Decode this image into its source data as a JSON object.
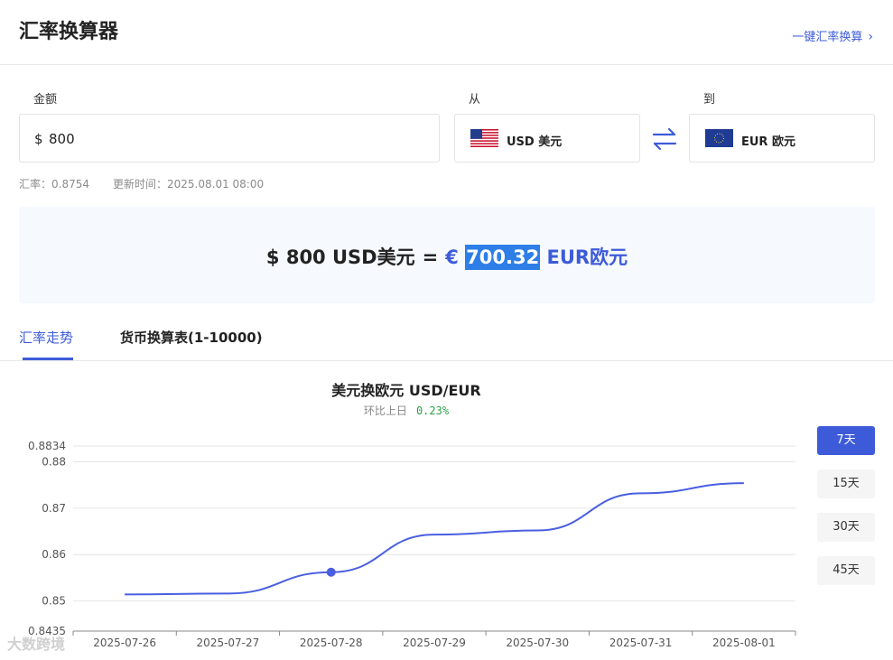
{
  "header": {
    "title": "汇率换算器",
    "quick_link": "一键汇率换算"
  },
  "form": {
    "amount_label": "金额",
    "amount_symbol": "$",
    "amount_value": "800",
    "from_label": "从",
    "from_currency": "USD  美元",
    "to_label": "到",
    "to_currency": "EUR  欧元"
  },
  "rate_info": {
    "rate": "汇率：0.8754",
    "updated": "更新时间：2025.08.01 08:00"
  },
  "result": {
    "left": "$ 800  USD美元",
    "equals": "=",
    "symbol": "€",
    "value": "700.32",
    "currency": "EUR欧元"
  },
  "tabs": [
    {
      "label": "汇率走势",
      "active": true
    },
    {
      "label": "货币换算表(1-10000)",
      "active": false
    }
  ],
  "chart_header": {
    "title": "美元换欧元   USD/EUR",
    "change_label": "环比上日",
    "change_value": "0.23%"
  },
  "ranges": [
    "7天",
    "15天",
    "30天",
    "45天"
  ],
  "colors": {
    "accent": "#3d5bd9",
    "positive": "#2ea04a",
    "line": "#4a5fe0"
  },
  "icons": {
    "swap": "swap-arrows-icon",
    "chevron": "chevron-right-icon"
  },
  "chart_data": {
    "type": "line",
    "title": "美元换欧元   USD/EUR",
    "x": [
      "2025-07-26",
      "2025-07-27",
      "2025-07-28",
      "2025-07-29",
      "2025-07-30",
      "2025-07-31",
      "2025-08-01"
    ],
    "values": [
      0.8514,
      0.8516,
      0.8562,
      0.8643,
      0.8652,
      0.8732,
      0.8754
    ],
    "ylim": [
      0.8435,
      0.8834
    ],
    "yticks": [
      "0.8834",
      "0.88",
      "0.87",
      "0.86",
      "0.85",
      "0.8435"
    ],
    "yticks_values": [
      0.8834,
      0.88,
      0.87,
      0.86,
      0.85,
      0.8435
    ],
    "highlight_index": 2,
    "grid": true,
    "legend": "none"
  },
  "watermark": "大数跨境"
}
